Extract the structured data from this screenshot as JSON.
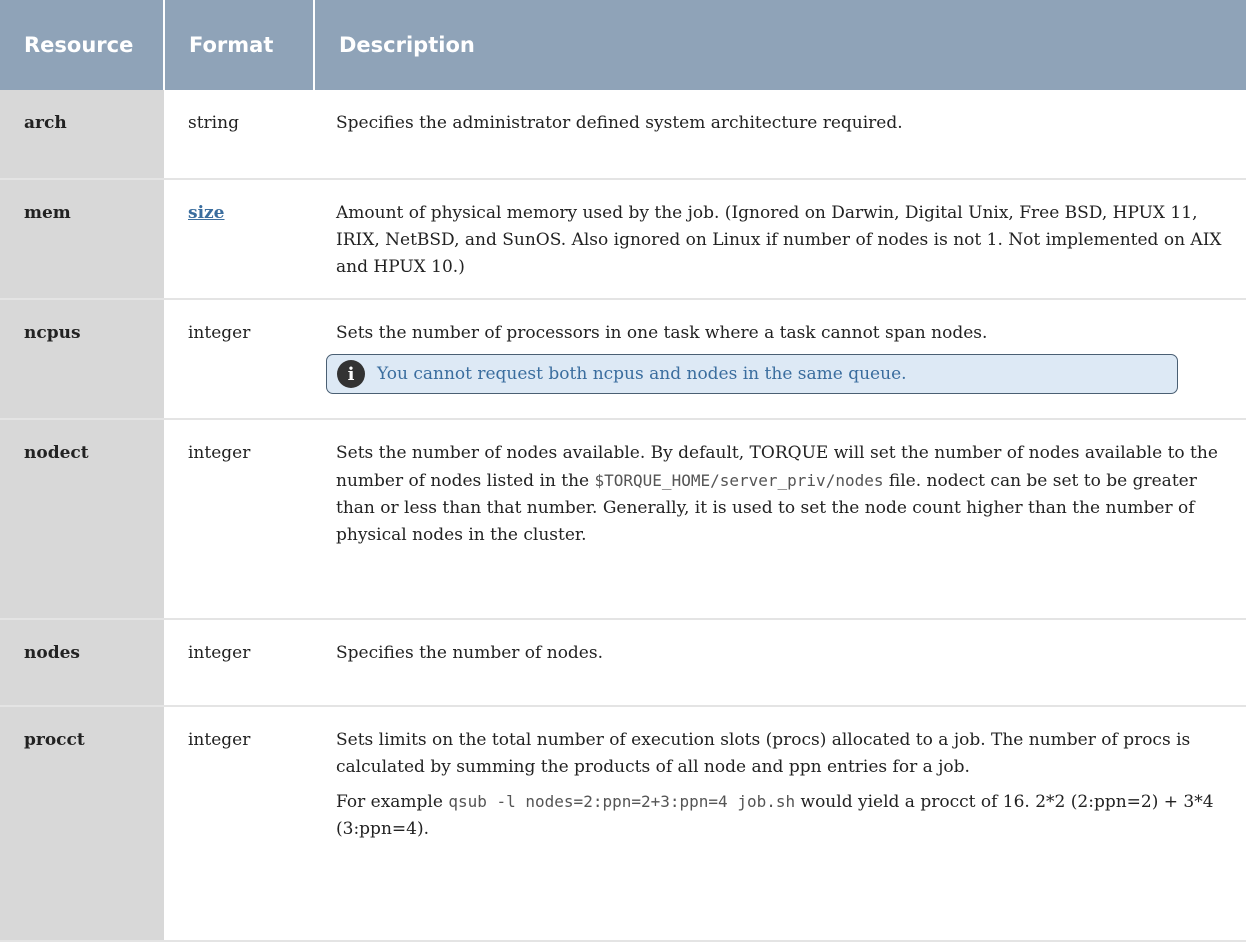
{
  "headers": {
    "resource": "Resource",
    "format": "Format",
    "description": "Description"
  },
  "rows": {
    "arch": {
      "name": "arch",
      "format": "string",
      "desc": "Specifies the administrator defined system architecture required."
    },
    "mem": {
      "name": "mem",
      "format": "size",
      "desc": "Amount of physical memory used by the job. (Ignored on Darwin, Digital Unix, Free BSD, HPUX 11, IRIX, NetBSD, and SunOS. Also ignored on Linux if number of nodes is not 1. Not implemented on AIX and HPUX 10.)"
    },
    "ncpus": {
      "name": "ncpus",
      "format": "integer",
      "desc": "Sets the number of processors in one task where a task cannot span nodes.",
      "note_icon": "info-icon",
      "note": "You cannot request both ncpus and nodes in the same queue."
    },
    "nodect": {
      "name": "nodect",
      "format": "integer",
      "desc_1": "Sets the number of nodes available. By default, TORQUE will set the number of nodes available to the number of nodes listed in the",
      "desc_code": "$TORQUE_HOME/server_priv/nodes",
      "desc_2": "file. nodect can be set to be greater than or less than that number. Generally, it is used to set the node count higher than the number of physical nodes in the cluster."
    },
    "nodes": {
      "name": "nodes",
      "format": "integer",
      "desc": "Specifies the number of nodes."
    },
    "procct": {
      "name": "procct",
      "format": "integer",
      "desc": "Sets limits on the total number of execution slots (procs) allocated to a job. The number of procs is calculated by summing the products of all node and ppn entries for a job.",
      "example_1": "For example",
      "example_code": "qsub -l nodes=2:ppn=2+3:ppn=4 job.sh",
      "example_2": "would yield a procct of 16. 2*2 (2:ppn=2) + 3*4 (3:ppn=4)."
    }
  },
  "colors": {
    "header_bg": "#8fa3b8",
    "name_cell_bg": "#d8d8d8",
    "link": "#3a6d9e",
    "note_bg": "#dde9f5"
  }
}
